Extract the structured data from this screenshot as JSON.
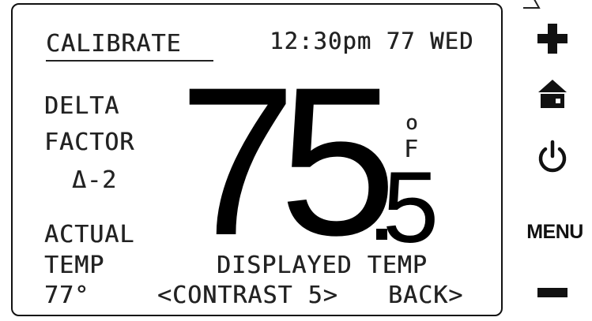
{
  "screen": {
    "title": "CALIBRATE",
    "clock": "12:30pm 77 WED",
    "delta_factor": {
      "line1": "DELTA",
      "line2": "FACTOR",
      "value": "Δ-2"
    },
    "actual_temp": {
      "line1": "ACTUAL",
      "line2": "TEMP",
      "value": "77°"
    },
    "temperature": {
      "whole": "75",
      "fraction": "5",
      "unit_degree": "o",
      "unit_letter": "F"
    },
    "displayed_temp_label": "DISPLAYED TEMP",
    "contrast_label": "<CONTRAST 5>",
    "back_label": "BACK>"
  },
  "buttons": {
    "plus_icon": "plus-icon",
    "home_icon": "home-icon",
    "power_icon": "power-icon",
    "menu_label": "MENU",
    "minus_icon": "minus-icon"
  },
  "colors": {
    "lcd_text": "#222222",
    "digits": "#000000",
    "buttons": "#111111"
  }
}
